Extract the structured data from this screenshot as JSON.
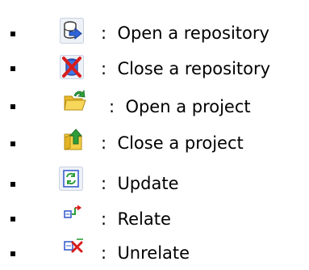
{
  "legend": {
    "items": [
      {
        "icon": "open-repository-icon",
        "separator": ":",
        "label": "Open a repository"
      },
      {
        "icon": "close-repository-icon",
        "separator": ":",
        "label": "Close a repository"
      },
      {
        "icon": "open-project-icon",
        "separator": ":",
        "label": "Open a project"
      },
      {
        "icon": "close-project-icon",
        "separator": ":",
        "label": "Close a project"
      },
      {
        "icon": "update-icon",
        "separator": ":",
        "label": "Update"
      },
      {
        "icon": "relate-icon",
        "separator": ":",
        "label": "Relate"
      },
      {
        "icon": "unrelate-icon",
        "separator": ":",
        "label": "Unrelate"
      }
    ]
  },
  "colors": {
    "text": "#000000",
    "bullet": "#000000",
    "icon_frame_blue": "#3a5fcd",
    "icon_folder_yellow": "#f3cf46",
    "icon_arrow_green": "#2e9e3a",
    "icon_cross_red": "#d91c1c"
  }
}
